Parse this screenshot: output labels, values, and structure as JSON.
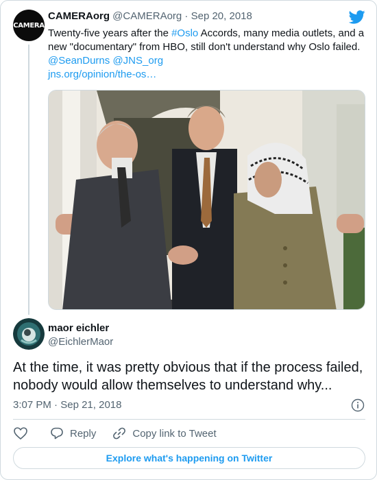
{
  "parent_tweet": {
    "avatar_text": "CAMERA",
    "display_name": "CAMERAorg",
    "handle": "@CAMERAorg",
    "separator": " · ",
    "date": "Sep 20, 2018",
    "text_before_hashtag": "Twenty-five years after the ",
    "hashtag": "#Oslo",
    "text_after_hashtag": " Accords, many media outlets, and a new \"documentary\" from HBO, still don't understand why Oslo failed.",
    "mention_1": "@SeanDurns",
    "mention_2": "@JNS_org",
    "link": "jns.org/opinion/the-os…",
    "photo_icon": "photo-handshake"
  },
  "reply_tweet": {
    "display_name": "maor eichler",
    "handle": "@EichlerMaor",
    "text": "At the time, it was pretty obvious that if the process failed, nobody would allow themselves to understand why...",
    "time": "3:07 PM",
    "date": "Sep 21, 2018",
    "timestamp_separator": " · "
  },
  "actions": {
    "like_icon": "heart-icon",
    "reply_icon": "reply-icon",
    "reply_label": "Reply",
    "copy_icon": "link-icon",
    "copy_label": "Copy link to Tweet"
  },
  "footer": {
    "explore_label": "Explore what's happening on Twitter"
  },
  "colors": {
    "link": "#1d9bf0",
    "secondary_text": "#536471",
    "border": "#cfd9de"
  }
}
